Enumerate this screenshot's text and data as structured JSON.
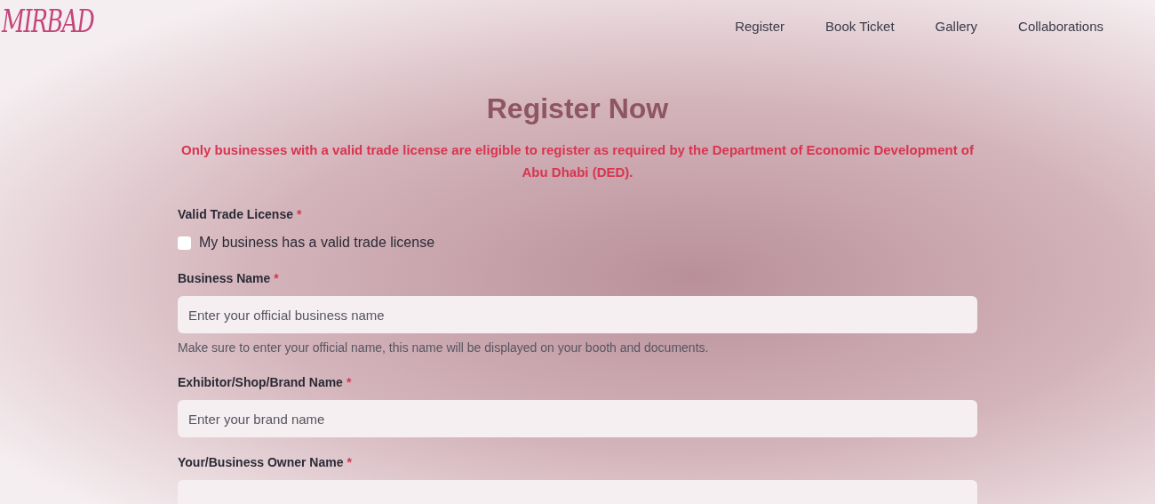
{
  "logo": {
    "text": "MIRBAD"
  },
  "nav": [
    {
      "label": "Register"
    },
    {
      "label": "Book Ticket"
    },
    {
      "label": "Gallery"
    },
    {
      "label": "Collaborations"
    }
  ],
  "title": "Register Now",
  "notice": "Only businesses with a valid trade license are eligible to register as required by the Department of Economic Development of Abu Dhabi (DED).",
  "fields": [
    {
      "kind": "checkbox",
      "label": "Valid Trade License",
      "required_mark": "*",
      "option": "My business has a valid trade license",
      "checked": false
    },
    {
      "kind": "text",
      "label": "Business Name",
      "required_mark": "*",
      "placeholder": "Enter your official business name",
      "help": "Make sure to enter your official name, this name will be displayed on your booth and documents."
    },
    {
      "kind": "text",
      "label": "Exhibitor/Shop/Brand Name",
      "required_mark": "*",
      "placeholder": "Enter your brand name"
    },
    {
      "kind": "text",
      "label": "Your/Business Owner Name",
      "required_mark": "*"
    }
  ]
}
